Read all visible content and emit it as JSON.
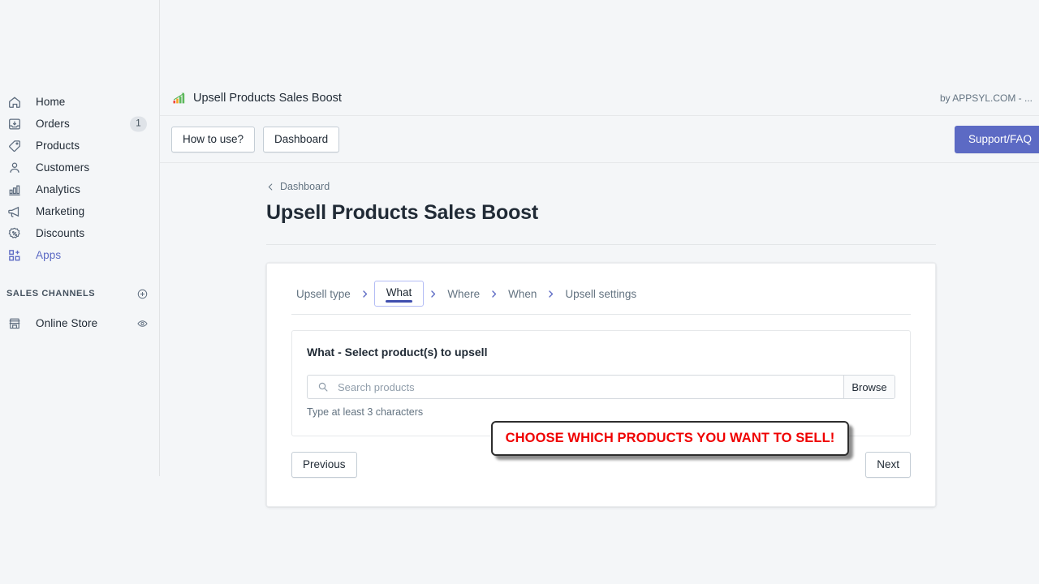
{
  "sidebar": {
    "items": [
      {
        "label": "Home",
        "icon": "home-icon",
        "badge": null,
        "active": false
      },
      {
        "label": "Orders",
        "icon": "orders-icon",
        "badge": "1",
        "active": false
      },
      {
        "label": "Products",
        "icon": "products-icon",
        "badge": null,
        "active": false
      },
      {
        "label": "Customers",
        "icon": "customers-icon",
        "badge": null,
        "active": false
      },
      {
        "label": "Analytics",
        "icon": "analytics-icon",
        "badge": null,
        "active": false
      },
      {
        "label": "Marketing",
        "icon": "marketing-icon",
        "badge": null,
        "active": false
      },
      {
        "label": "Discounts",
        "icon": "discounts-icon",
        "badge": null,
        "active": false
      },
      {
        "label": "Apps",
        "icon": "apps-icon",
        "badge": null,
        "active": true
      }
    ],
    "sales_channels": {
      "title": "SALES CHANNELS",
      "add_icon": "plus-circle-icon",
      "items": [
        {
          "label": "Online Store",
          "icon": "storefront-icon",
          "trailing_icon": "eye-icon"
        }
      ]
    }
  },
  "app": {
    "icon": "bar-chart-icon",
    "title": "Upsell Products Sales Boost",
    "author": "by APPSYL.COM - ...",
    "actions": [
      {
        "label": "How to use?"
      },
      {
        "label": "Dashboard"
      }
    ],
    "support_label": "Support/FAQ",
    "accent_color": "#5c6ac4"
  },
  "page": {
    "breadcrumb": {
      "icon": "chevron-left-icon",
      "label": "Dashboard"
    },
    "title": "Upsell Products Sales Boost"
  },
  "wizard": {
    "separator": "›",
    "steps": [
      {
        "label": "Upsell type",
        "active": false
      },
      {
        "label": "What",
        "active": true
      },
      {
        "label": "Where",
        "active": false
      },
      {
        "label": "When",
        "active": false
      },
      {
        "label": "Upsell settings",
        "active": false
      }
    ]
  },
  "step_panel": {
    "title": "What - Select product(s) to upsell",
    "search": {
      "icon": "search-icon",
      "value": "",
      "placeholder": "Search products"
    },
    "browse_label": "Browse",
    "helper_text": "Type at least 3 characters"
  },
  "footer": {
    "previous_label": "Previous",
    "next_label": "Next"
  },
  "callout": {
    "text": "CHOOSE WHICH PRODUCTS YOU WANT TO SELL!",
    "color": "#ef0000"
  }
}
